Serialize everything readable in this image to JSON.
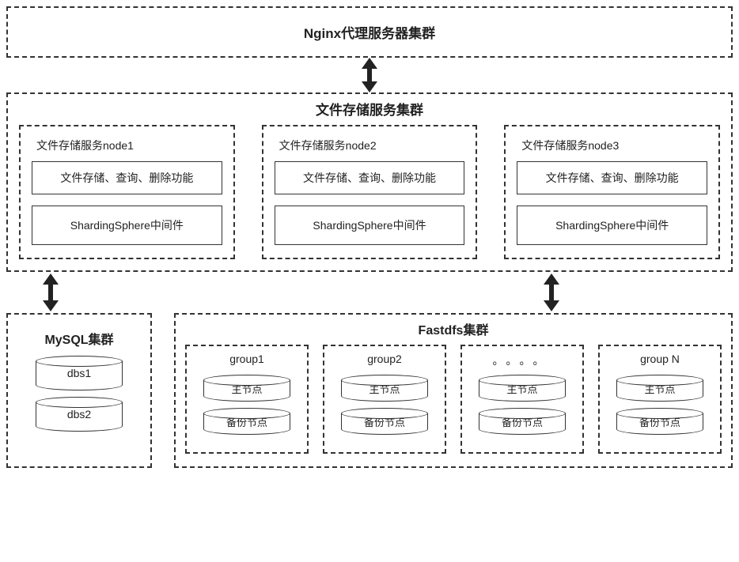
{
  "nginx": {
    "title": "Nginx代理服务器集群"
  },
  "fileCluster": {
    "title": "文件存储服务集群",
    "nodes": [
      {
        "name": "文件存储服务node1",
        "func": "文件存储、查询、删除功能",
        "mw": "ShardingSphere中间件"
      },
      {
        "name": "文件存储服务node2",
        "func": "文件存储、查询、删除功能",
        "mw": "ShardingSphere中间件"
      },
      {
        "name": "文件存储服务node3",
        "func": "文件存储、查询、删除功能",
        "mw": "ShardingSphere中间件"
      }
    ]
  },
  "mysql": {
    "title": "MySQL集群",
    "dbs": [
      "dbs1",
      "dbs2"
    ]
  },
  "fastdfs": {
    "title": "Fastdfs集群",
    "groups": [
      {
        "name": "group1",
        "master": "主节点",
        "backup": "备份节点",
        "ellipsis": false
      },
      {
        "name": "group2",
        "master": "主节点",
        "backup": "备份节点",
        "ellipsis": false
      },
      {
        "name": "",
        "master": "主节点",
        "backup": "备份节点",
        "ellipsis": true
      },
      {
        "name": "group N",
        "master": "主节点",
        "backup": "备份节点",
        "ellipsis": false
      }
    ]
  }
}
